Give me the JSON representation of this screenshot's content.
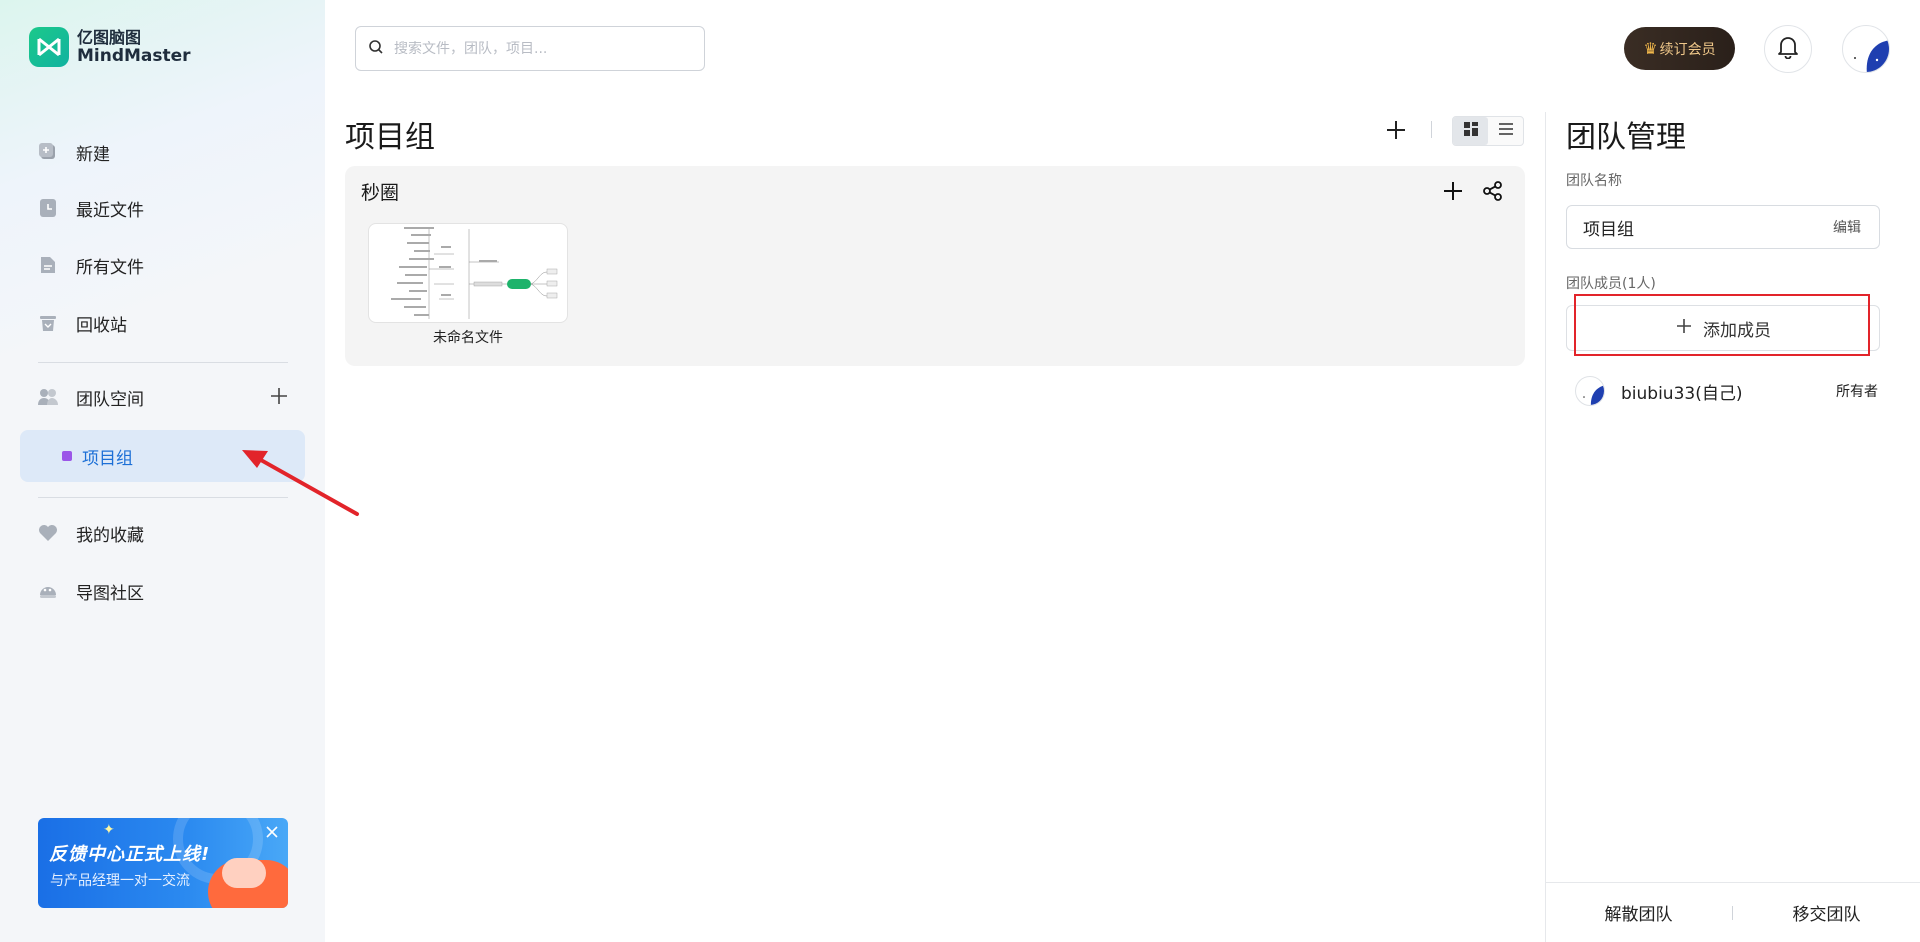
{
  "app": {
    "logo_cn": "亿图脑图",
    "logo_en": "MindMaster"
  },
  "sidebar": {
    "items": [
      {
        "label": "新建",
        "icon": "new-file-icon"
      },
      {
        "label": "最近文件",
        "icon": "recent-clock-icon"
      },
      {
        "label": "所有文件",
        "icon": "all-files-icon"
      },
      {
        "label": "回收站",
        "icon": "trash-icon"
      }
    ],
    "team_space": {
      "label": "团队空间",
      "icon": "team-icon"
    },
    "team_item": {
      "label": "项目组"
    },
    "bottom_items": [
      {
        "label": "我的收藏",
        "icon": "heart-icon"
      },
      {
        "label": "导图社区",
        "icon": "community-icon"
      }
    ],
    "banner": {
      "title": "反馈中心正式上线!",
      "subtitle": "与产品经理一对一交流"
    }
  },
  "header": {
    "search_placeholder": "搜索文件，团队，项目...",
    "vip_label": "续订会员"
  },
  "main": {
    "title": "项目组",
    "folder": {
      "title": "秒圈",
      "files": [
        {
          "name": "未命名文件"
        }
      ]
    }
  },
  "team_panel": {
    "title": "团队管理",
    "name_label": "团队名称",
    "name_value": "项目组",
    "edit_label": "编辑",
    "members_label": "团队成员(1人)",
    "add_member_label": "添加成员",
    "members": [
      {
        "name": "biubiu33(自己)",
        "role": "所有者"
      }
    ],
    "dissolve_label": "解散团队",
    "transfer_label": "移交团队"
  },
  "colors": {
    "brand": "#18c08f",
    "accent": "#1c6fd6",
    "highlight_box": "#e2242a",
    "annotation_arrow": "#e2242a"
  }
}
